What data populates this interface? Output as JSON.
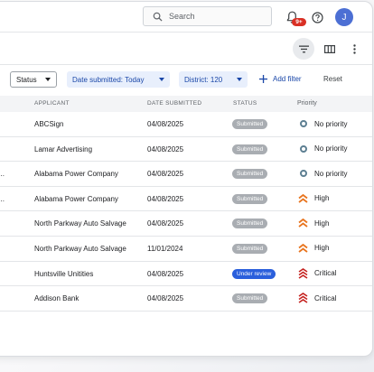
{
  "search": {
    "placeholder": "Search"
  },
  "notifications": {
    "badge": "9+"
  },
  "user": {
    "initial": "J"
  },
  "filters": {
    "status_label": "Status",
    "date_label": "Date submitted: Today",
    "district_label": "District: 120",
    "add_filter_label": "Add filter",
    "reset_label": "Reset"
  },
  "table": {
    "headers": {
      "applicant": "APPLICANT",
      "date": "DATE SUBMITTED",
      "status": "STATUS",
      "priority": "Priority"
    },
    "rows": [
      {
        "code": "",
        "applicant": "ABCSign",
        "date": "04/08/2025",
        "status": "Submitted",
        "priority": "No priority",
        "priority_level": "none"
      },
      {
        "code": "",
        "applicant": "Lamar Advertising",
        "date": "04/08/2025",
        "status": "Submitted",
        "priority": "No priority",
        "priority_level": "none"
      },
      {
        "code": "t-o...",
        "applicant": "Alabama Power Company",
        "date": "04/08/2025",
        "status": "Submitted",
        "priority": "No priority",
        "priority_level": "none"
      },
      {
        "code": "t-o...",
        "applicant": "Alabama Power Company",
        "date": "04/08/2025",
        "status": "Submitted",
        "priority": "High",
        "priority_level": "high"
      },
      {
        "code": "",
        "applicant": "North Parkway Auto Salvage",
        "date": "04/08/2025",
        "status": "Submitted",
        "priority": "High",
        "priority_level": "high"
      },
      {
        "code": "",
        "applicant": "North Parkway Auto Salvage",
        "date": "11/01/2024",
        "status": "Submitted",
        "priority": "High",
        "priority_level": "high"
      },
      {
        "code": "",
        "applicant": "Huntsville Unitities",
        "date": "04/08/2025",
        "status": "Under review",
        "priority": "Critical",
        "priority_level": "critical"
      },
      {
        "code": "",
        "applicant": "Addison Bank",
        "date": "04/08/2025",
        "status": "Submitted",
        "priority": "Critical",
        "priority_level": "critical"
      }
    ]
  },
  "colors": {
    "accent": "#1a47a8",
    "chip_bg": "#e8effc",
    "submitted_pill": "#a9adb2",
    "review_pill": "#2a5fdc",
    "high": "#e8741e",
    "critical": "#c5221f",
    "no_priority": "#5d7f92"
  },
  "icons": [
    "search-icon",
    "bell-icon",
    "help-icon",
    "filter-icon",
    "columns-icon",
    "more-vert-icon",
    "plus-icon",
    "chevron-up-icon",
    "double-chevron-up-icon",
    "ring-icon"
  ]
}
